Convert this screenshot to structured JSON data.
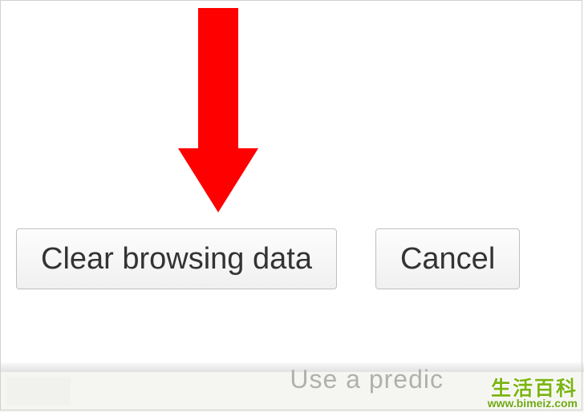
{
  "buttons": {
    "clear_label": "Clear browsing data",
    "cancel_label": "Cancel"
  },
  "background": {
    "partial_text": "Use a predic"
  },
  "watermark": {
    "title": "生活百科",
    "url": "www.bimeiz.com"
  },
  "annotation": {
    "arrow_color": "#ff0000"
  }
}
